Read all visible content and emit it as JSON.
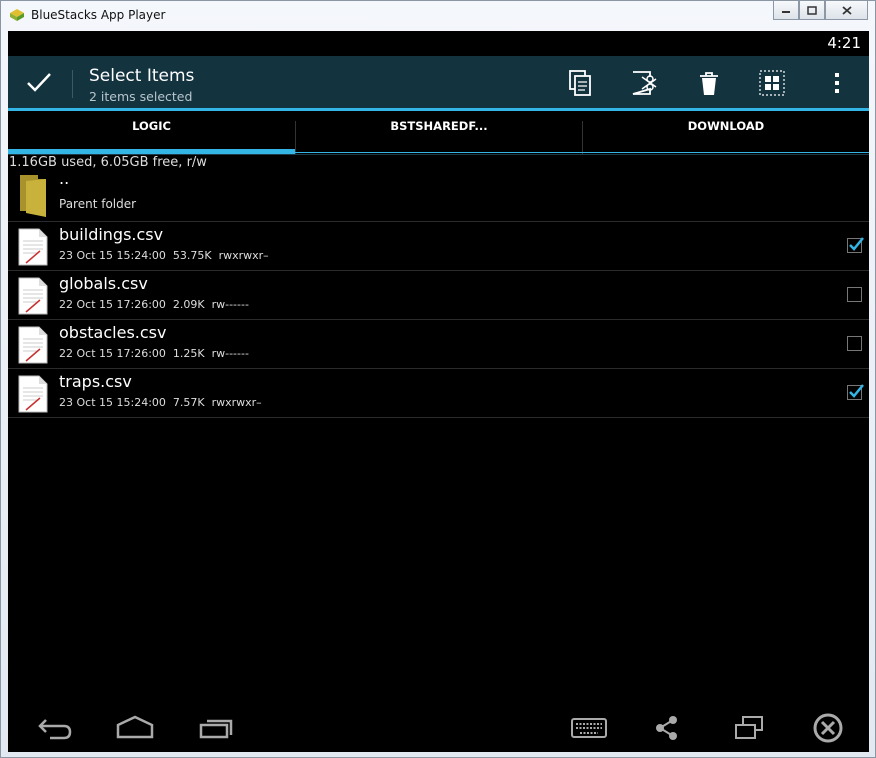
{
  "window": {
    "title": "BlueStacks App Player"
  },
  "status": {
    "time": "4:21"
  },
  "actionbar": {
    "title": "Select Items",
    "subtitle": "2 items selected",
    "icons": [
      "check-icon",
      "copy-icon",
      "cut-icon",
      "trash-icon",
      "select-all-icon",
      "overflow-menu-icon"
    ]
  },
  "tabs": [
    {
      "label": "LOGIC",
      "selected": true
    },
    {
      "label": "BSTSHAREDF...",
      "selected": false
    },
    {
      "label": "DOWNLOAD",
      "selected": false
    }
  ],
  "storage": {
    "text": "1.16GB used, 6.05GB free, r/w"
  },
  "parent": {
    "name": "..",
    "label": "Parent folder"
  },
  "files": [
    {
      "name": "buildings.csv",
      "meta": "23 Oct 15 15:24:00  53.75K  rwxrwxr–",
      "checked": true
    },
    {
      "name": "globals.csv",
      "meta": "22 Oct 15 17:26:00  2.09K  rw------",
      "checked": false
    },
    {
      "name": "obstacles.csv",
      "meta": "22 Oct 15 17:26:00  1.25K  rw------",
      "checked": false
    },
    {
      "name": "traps.csv",
      "meta": "23 Oct 15 15:24:00  7.57K  rwxrwxr–",
      "checked": true
    }
  ],
  "navbar": {
    "icons": [
      "back-icon",
      "home-icon",
      "recent-apps-icon",
      "keyboard-icon",
      "share-icon",
      "window-toggle-icon",
      "close-app-icon"
    ]
  },
  "colors": {
    "accent": "#33b5e5",
    "actionbar": "#13333f",
    "folder": "#c8b23c"
  }
}
